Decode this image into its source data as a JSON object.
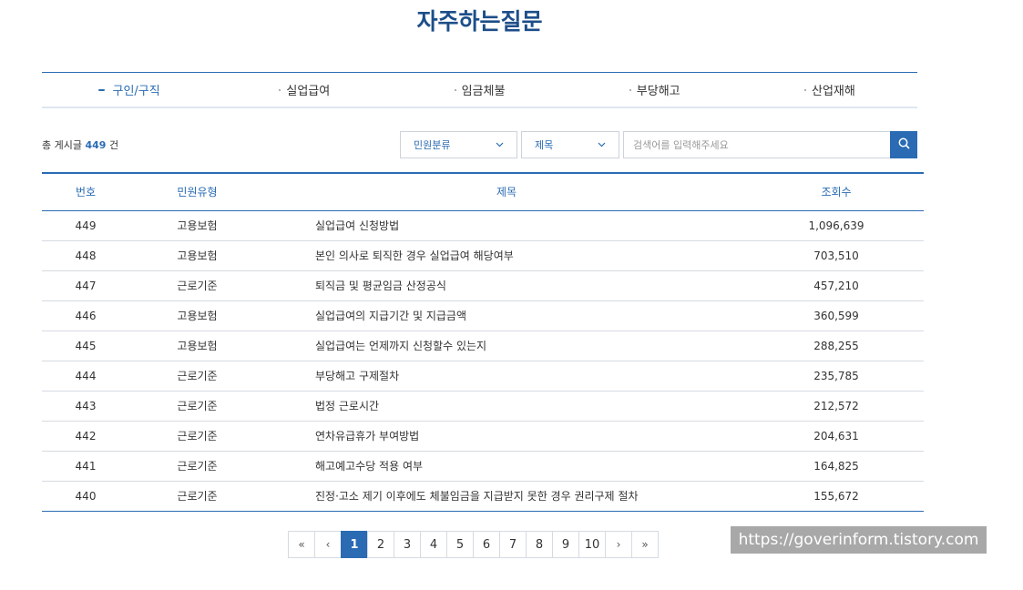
{
  "page": {
    "title": "자주하는질문"
  },
  "tabs": [
    {
      "label": "구인/구직",
      "active": true
    },
    {
      "label": "실업급여",
      "active": false
    },
    {
      "label": "임금체불",
      "active": false
    },
    {
      "label": "부당해고",
      "active": false
    },
    {
      "label": "산업재해",
      "active": false
    }
  ],
  "summary": {
    "prefix": "총 게시글",
    "count": "449",
    "suffix": "건"
  },
  "filters": {
    "category": {
      "value": "민원분류",
      "icon": "chevron-down-icon"
    },
    "field": {
      "value": "제목",
      "icon": "chevron-down-icon"
    },
    "search": {
      "placeholder": "검색어를 입력해주세요",
      "value": "",
      "icon": "search-icon"
    }
  },
  "table": {
    "headers": {
      "num": "번호",
      "type": "민원유형",
      "title": "제목",
      "views": "조회수"
    },
    "rows": [
      {
        "num": "449",
        "type": "고용보험",
        "title": "실업급여 신청방법",
        "views": "1,096,639"
      },
      {
        "num": "448",
        "type": "고용보험",
        "title": "본인 의사로 퇴직한 경우 실업급여 해당여부",
        "views": "703,510"
      },
      {
        "num": "447",
        "type": "근로기준",
        "title": "퇴직금 및 평균임금 산정공식",
        "views": "457,210"
      },
      {
        "num": "446",
        "type": "고용보험",
        "title": "실업급여의 지급기간 및 지급금액",
        "views": "360,599"
      },
      {
        "num": "445",
        "type": "고용보험",
        "title": "실업급여는 언제까지 신청할수 있는지",
        "views": "288,255"
      },
      {
        "num": "444",
        "type": "근로기준",
        "title": "부당해고 구제절차",
        "views": "235,785"
      },
      {
        "num": "443",
        "type": "근로기준",
        "title": "법정 근로시간",
        "views": "212,572"
      },
      {
        "num": "442",
        "type": "근로기준",
        "title": "연차유급휴가 부여방법",
        "views": "204,631"
      },
      {
        "num": "441",
        "type": "근로기준",
        "title": "해고예고수당 적용 여부",
        "views": "164,825"
      },
      {
        "num": "440",
        "type": "근로기준",
        "title": "진정·고소 제기 이후에도 체불임금을 지급받지 못한 경우 권리구제 절차",
        "views": "155,672"
      }
    ]
  },
  "pagination": {
    "first": "«",
    "prev": "‹",
    "next": "›",
    "last": "»",
    "pages": [
      "1",
      "2",
      "3",
      "4",
      "5",
      "6",
      "7",
      "8",
      "9",
      "10"
    ],
    "current": "1"
  },
  "watermark": "https://goverinform.tistory.com",
  "colors": {
    "accent": "#2a6bb3",
    "title": "#1d4e89",
    "watermark_bg": "#a8a8a8"
  }
}
